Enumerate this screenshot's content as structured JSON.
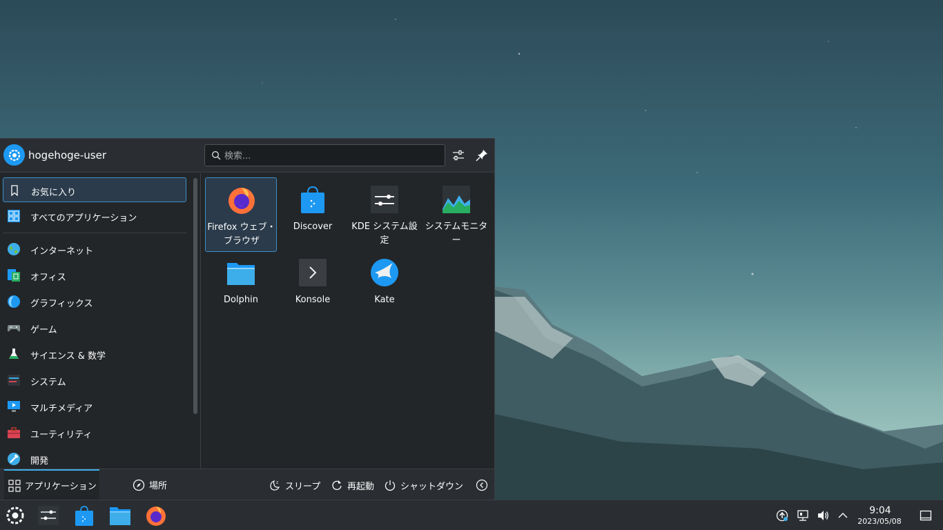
{
  "launcher": {
    "user_name": "hogehoge-user",
    "search_placeholder": "検索...",
    "categories": [
      {
        "label": "お気に入り",
        "icon": "bookmark-icon",
        "active": true
      },
      {
        "label": "すべてのアプリケーション",
        "icon": "all-apps-icon"
      },
      {
        "label": "インターネット",
        "icon": "internet-icon"
      },
      {
        "label": "オフィス",
        "icon": "office-icon"
      },
      {
        "label": "グラフィックス",
        "icon": "graphics-icon"
      },
      {
        "label": "ゲーム",
        "icon": "gamepad-icon"
      },
      {
        "label": "サイエンス & 数学",
        "icon": "science-icon"
      },
      {
        "label": "システム",
        "icon": "system-icon"
      },
      {
        "label": "マルチメディア",
        "icon": "multimedia-icon"
      },
      {
        "label": "ユーティリティ",
        "icon": "utilities-icon"
      },
      {
        "label": "開発",
        "icon": "development-icon"
      }
    ],
    "favorites": [
      {
        "label": "Firefox ウェブ・ブラウザ",
        "icon": "firefox-icon",
        "active": true
      },
      {
        "label": "Discover",
        "icon": "discover-icon"
      },
      {
        "label": "KDE システム設定",
        "icon": "system-settings-icon"
      },
      {
        "label": "システムモニター",
        "icon": "system-monitor-icon"
      },
      {
        "label": "Dolphin",
        "icon": "dolphin-folder-icon"
      },
      {
        "label": "Konsole",
        "icon": "konsole-icon"
      },
      {
        "label": "Kate",
        "icon": "kate-icon"
      }
    ],
    "footer": {
      "tab_applications": "アプリケーション",
      "tab_places": "場所",
      "sleep": "スリープ",
      "restart": "再起動",
      "shutdown": "シャットダウン"
    }
  },
  "taskbar": {
    "time": "9:04",
    "date": "2023/05/08"
  },
  "colors": {
    "accent": "#3daee9",
    "panel": "#232629",
    "header": "#2a2e32"
  }
}
